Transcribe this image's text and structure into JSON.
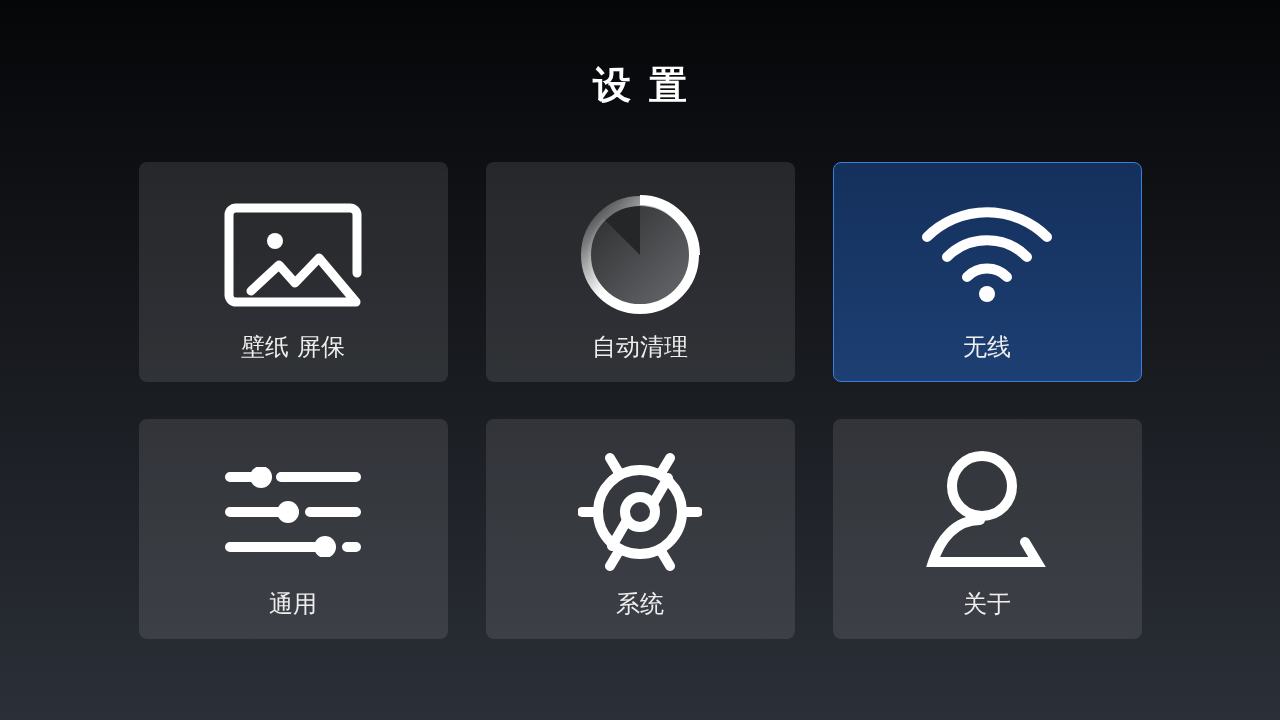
{
  "title": "设置",
  "tiles": [
    {
      "label": "壁纸 屏保",
      "kind": "wallpaper",
      "selected": false
    },
    {
      "label": "自动清理",
      "kind": "cleanup",
      "selected": false
    },
    {
      "label": "无线",
      "kind": "wifi",
      "selected": true
    },
    {
      "label": "通用",
      "kind": "sliders",
      "selected": false
    },
    {
      "label": "系统",
      "kind": "wheel",
      "selected": false
    },
    {
      "label": "关于",
      "kind": "person",
      "selected": false
    }
  ]
}
